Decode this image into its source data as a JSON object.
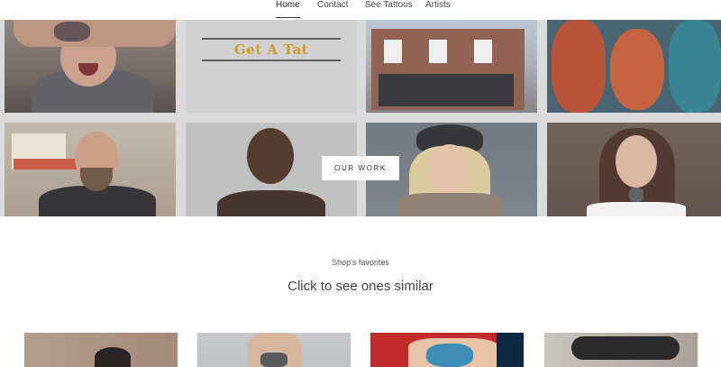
{
  "nav": {
    "items": [
      {
        "label": "Home",
        "active": true
      },
      {
        "label": "Contact",
        "active": false
      },
      {
        "label": "See Tattoos",
        "active": false
      },
      {
        "label": "Artists",
        "active": false
      }
    ]
  },
  "hero": {
    "logo_text": "Get A Tat",
    "cta_label": "OUR WORK",
    "tiles": [
      "man-with-tattooed-arm-photo",
      "get-a-tat-logo",
      "shop-storefront-photo",
      "koi-tattoo-artwork",
      "bearded-artist-photo",
      "tattooed-man-portrait",
      "woman-in-hat-photo",
      "woman-with-neck-tattoo-photo"
    ]
  },
  "favorites": {
    "subtitle": "Shop's favorites",
    "title": "Click to see ones similar",
    "cards": [
      "bird-tattoo-arm",
      "back-tattoo",
      "colorful-tattoo",
      "forearm-tattoo"
    ]
  },
  "colors": {
    "accent": "#333333",
    "background": "#ffffff",
    "logo_text": "#c9961e"
  }
}
